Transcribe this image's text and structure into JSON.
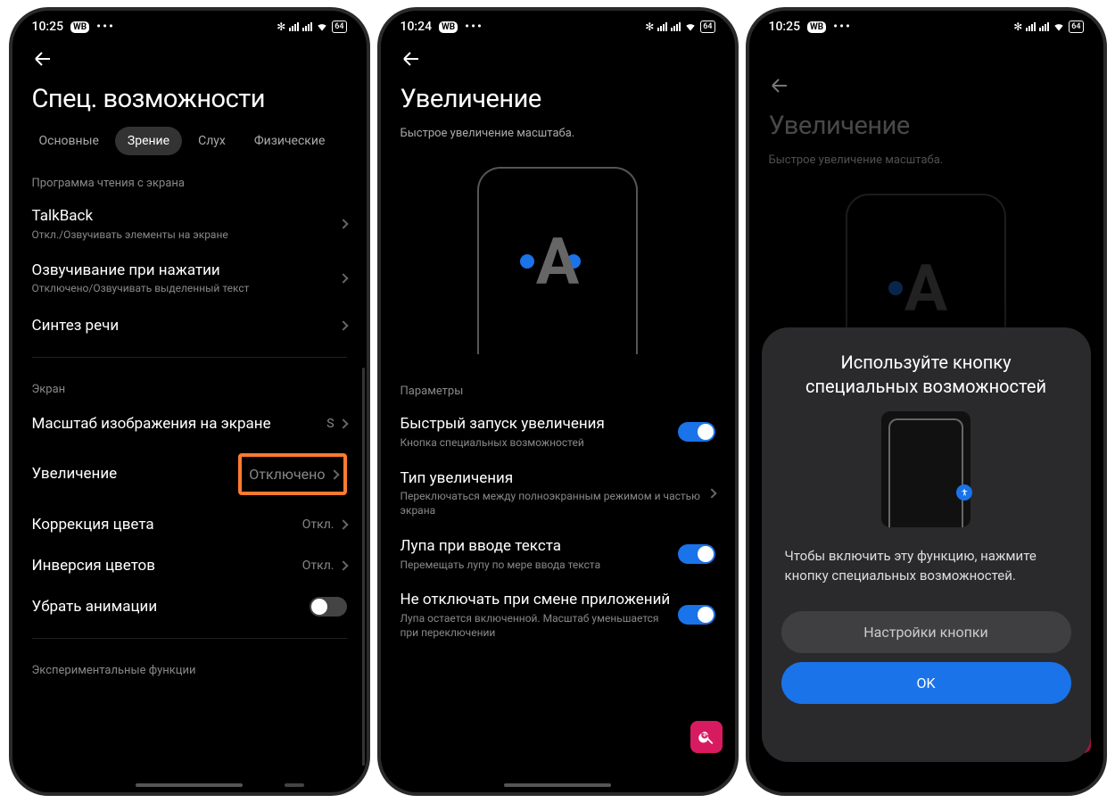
{
  "statusbar": {
    "time_a": "10:25",
    "time_b": "10:24",
    "time_c": "10:25",
    "badge": "WB",
    "battery": "64"
  },
  "screen1": {
    "title": "Спец. возможности",
    "tabs": [
      "Основные",
      "Зрение",
      "Слух",
      "Физические"
    ],
    "active_tab": 1,
    "section_reader": "Программа чтения с экрана",
    "talkback": {
      "title": "TalkBack",
      "sub": "Откл./Озвучивать элементы на экране"
    },
    "taptospeak": {
      "title": "Озвучивание при нажатии",
      "sub": "Отключено/Озвучивать выделенный текст"
    },
    "tts": {
      "title": "Синтез речи"
    },
    "section_screen": "Экран",
    "displayscale": {
      "title": "Масштаб изображения на экране",
      "value": "S"
    },
    "magnify": {
      "title": "Увеличение",
      "value": "Отключено"
    },
    "colorcorr": {
      "title": "Коррекция цвета",
      "value": "Откл."
    },
    "invert": {
      "title": "Инверсия цветов",
      "value": "Откл."
    },
    "removeanim": {
      "title": "Убрать анимации"
    },
    "section_exp": "Экспериментальные функции"
  },
  "screen2": {
    "title": "Увеличение",
    "subtitle": "Быстрое увеличение масштаба.",
    "section_params": "Параметры",
    "quick": {
      "title": "Быстрый запуск увеличения",
      "sub": "Кнопка специальных возможностей"
    },
    "type": {
      "title": "Тип увеличения",
      "sub": "Переключаться между полноэкранным режимом и частью экрана"
    },
    "typing": {
      "title": "Лупа при вводе текста",
      "sub": "Перемещать лупу по мере ввода текста"
    },
    "keep": {
      "title": "Не отключать при смене приложений",
      "sub": "Лупа остается включенной. Масштаб уменьшается при переключении"
    }
  },
  "dialog": {
    "title": "Используйте кнопку специальных возможностей",
    "text": "Чтобы включить эту функцию, нажмите кнопку специальных возможностей.",
    "btn_settings": "Настройки кнопки",
    "btn_ok": "OK"
  }
}
